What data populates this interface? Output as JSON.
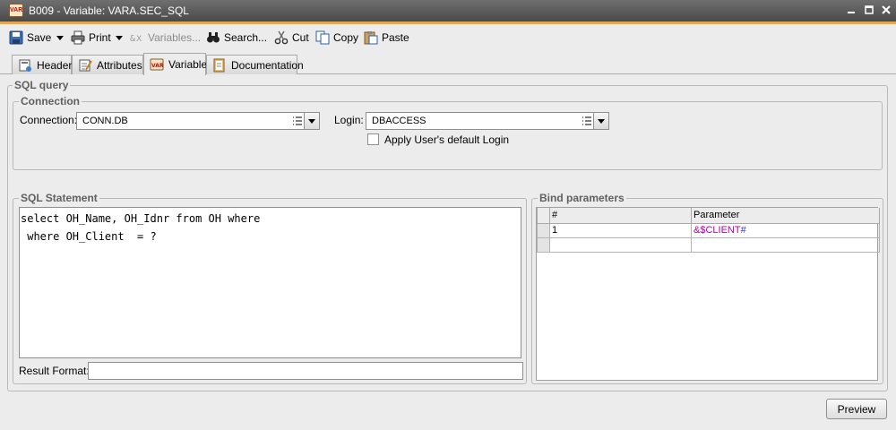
{
  "window": {
    "title": "B009 - Variable: VARA.SEC_SQL",
    "app_icon_text": "VAR"
  },
  "toolbar": {
    "save_label": "Save",
    "print_label": "Print",
    "variables_label": "Variables...",
    "search_label": "Search...",
    "cut_label": "Cut",
    "copy_label": "Copy",
    "paste_label": "Paste"
  },
  "tabs": [
    {
      "label": "Header",
      "active": false
    },
    {
      "label": "Attributes",
      "active": false
    },
    {
      "label": "Variable",
      "active": true
    },
    {
      "label": "Documentation",
      "active": false
    }
  ],
  "sql_query": {
    "legend": "SQL query",
    "connection_group": {
      "legend": "Connection",
      "connection_label": "Connection:",
      "connection_value": "CONN.DB",
      "login_label": "Login:",
      "login_value": "DBACCESS",
      "apply_default_login_label": "Apply User's default Login",
      "apply_default_login_checked": false
    },
    "sql_statement": {
      "legend": "SQL Statement",
      "text": "select OH_Name, OH_Idnr from OH where\n where OH_Client  = ?",
      "result_format_label": "Result Format:",
      "result_format_value": ""
    },
    "bind_parameters": {
      "legend": "Bind parameters",
      "columns": [
        "#",
        "Parameter"
      ],
      "rows": [
        {
          "num": "1",
          "parameter_prefix": "&",
          "parameter_name": "$CLIENT",
          "parameter_suffix": "#"
        },
        {
          "num": "",
          "parameter_prefix": "",
          "parameter_name": "",
          "parameter_suffix": ""
        }
      ]
    }
  },
  "preview_label": "Preview",
  "colors": {
    "titlebar": "#5a5a5a",
    "accent": "#f2a33a",
    "parameter_text": "#b000b0"
  }
}
